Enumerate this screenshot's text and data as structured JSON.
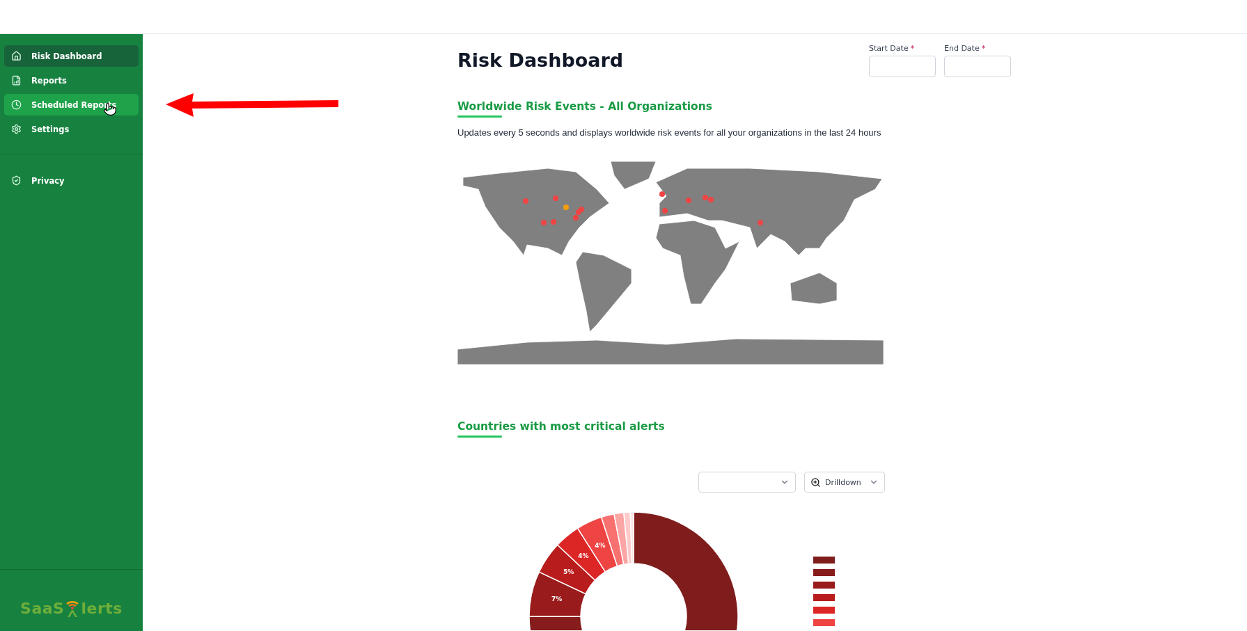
{
  "sidebar": {
    "items": [
      {
        "label": "Risk Dashboard",
        "selected": true,
        "hovered": false
      },
      {
        "label": "Reports",
        "selected": false,
        "hovered": false
      },
      {
        "label": "Scheduled Reports",
        "selected": false,
        "hovered": true
      },
      {
        "label": "Settings",
        "selected": false,
        "hovered": false
      }
    ],
    "secondary_items": [
      {
        "label": "Privacy",
        "selected": false,
        "hovered": false
      }
    ],
    "logo": {
      "left": "SaaS",
      "right": "lerts"
    }
  },
  "header": {
    "title": "Risk Dashboard",
    "date_fields": [
      {
        "label": "Start Date",
        "marker": "*"
      },
      {
        "label": "End Date",
        "marker": "*"
      }
    ]
  },
  "map_section": {
    "title": "Worldwide Risk Events - All Organizations",
    "description": "Updates every 5 seconds and displays worldwide risk events for all your organizations in the last 24 hours"
  },
  "countries_section": {
    "title": "Countries with most critical alerts",
    "drilldown": {
      "label": "Drilldown"
    },
    "donut_labels": [
      "7%",
      "5%",
      "4%",
      "4%"
    ]
  }
}
